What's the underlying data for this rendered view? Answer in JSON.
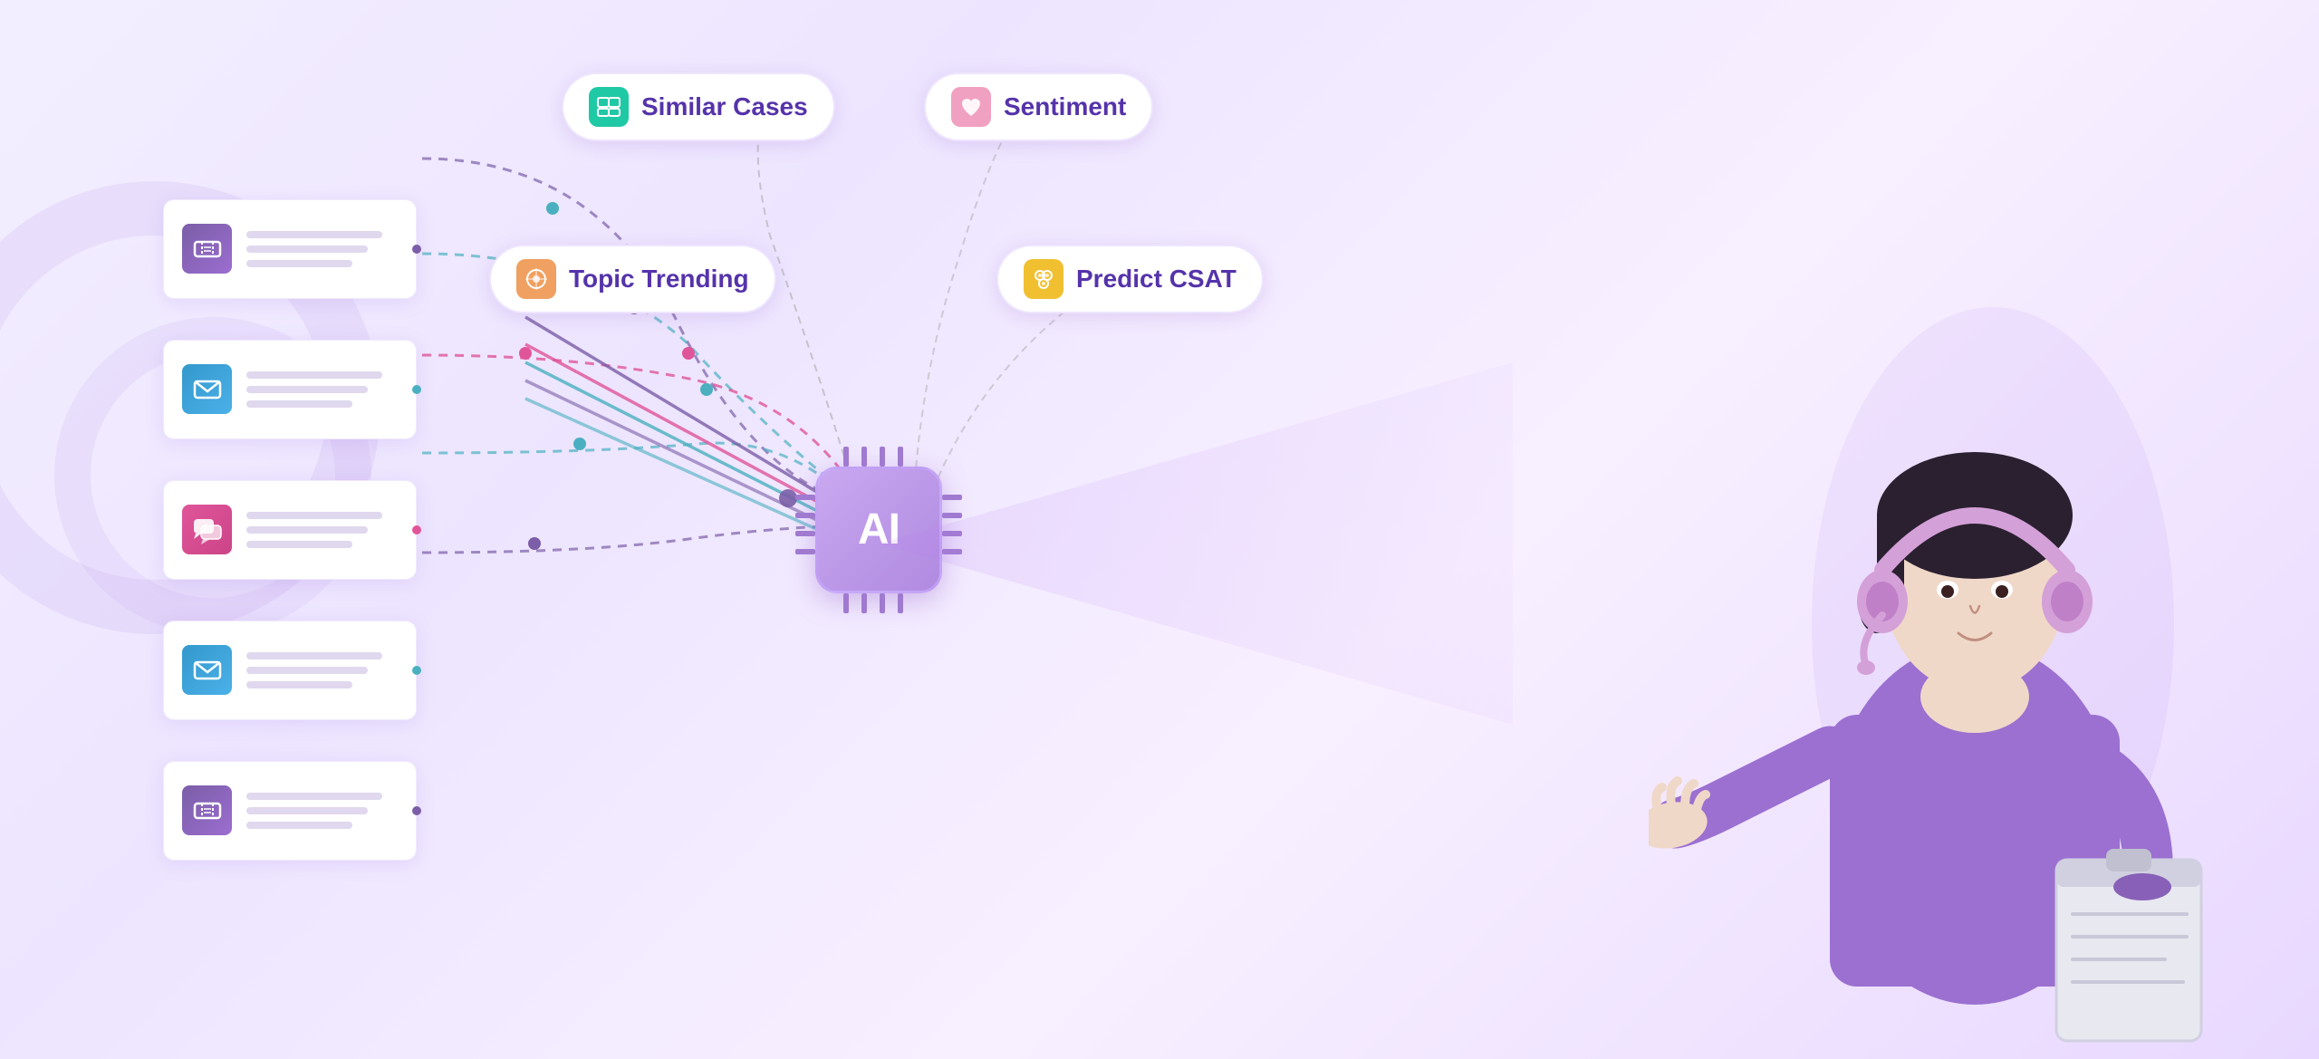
{
  "background": {
    "color_start": "#f3eeff",
    "color_end": "#e8d8ff"
  },
  "cards": [
    {
      "id": "card-1",
      "type": "ticket",
      "icon_type": "ticket-purple",
      "dot_color": "purple"
    },
    {
      "id": "card-2",
      "type": "email",
      "icon_type": "email-blue",
      "dot_color": "teal"
    },
    {
      "id": "card-3",
      "type": "chat",
      "icon_type": "chat-pink",
      "dot_color": "pink"
    },
    {
      "id": "card-4",
      "type": "email",
      "icon_type": "email-blue2",
      "dot_color": "teal"
    },
    {
      "id": "card-5",
      "type": "ticket",
      "icon_type": "ticket-purple2",
      "dot_color": "purple"
    }
  ],
  "ai_label": "AI",
  "feature_badges": [
    {
      "id": "similar-cases",
      "label": "Similar Cases",
      "icon_color": "teal",
      "position": "top-left"
    },
    {
      "id": "sentiment",
      "label": "Sentiment",
      "icon_color": "pink",
      "position": "top-right"
    },
    {
      "id": "topic-trending",
      "label": "Topic Trending",
      "icon_color": "orange",
      "position": "mid-left"
    },
    {
      "id": "predict-csat",
      "label": "Predict CSAT",
      "icon_color": "yellow",
      "position": "mid-right"
    }
  ]
}
